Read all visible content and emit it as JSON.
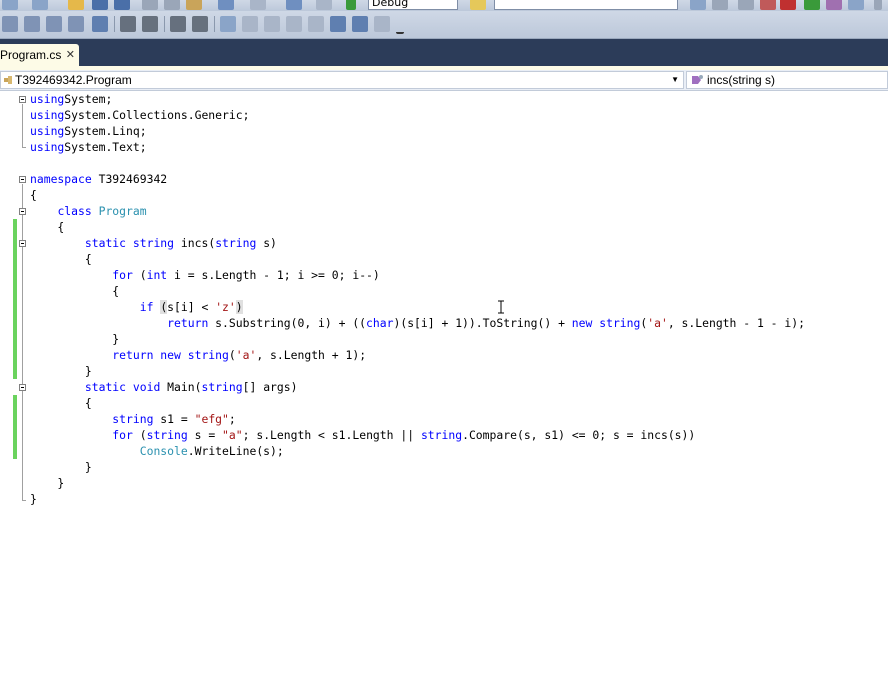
{
  "toolbar": {
    "config_value": "Debug",
    "find_value": ""
  },
  "tab": {
    "label": "Program.cs",
    "close_glyph": "✕"
  },
  "navbar": {
    "type_selector": "T392469342.Program",
    "member_selector": "incs(string s)"
  },
  "code": {
    "l1": [
      [
        "kw",
        "using"
      ],
      [
        "",
        "System;"
      ]
    ],
    "l2": [
      [
        "kw",
        "using"
      ],
      [
        "",
        "System.Collections.Generic;"
      ]
    ],
    "l3": [
      [
        "kw",
        "using"
      ],
      [
        "",
        "System.Linq;"
      ]
    ],
    "l4": [
      [
        "kw",
        "using"
      ],
      [
        "",
        "System.Text;"
      ]
    ],
    "l6": [
      [
        "kw",
        "namespace"
      ],
      [
        "",
        " T392469342"
      ]
    ],
    "l7": [
      [
        "",
        "{"
      ]
    ],
    "l8": [
      [
        "",
        "    "
      ],
      [
        "kw",
        "class"
      ],
      [
        "",
        ""
      ],
      [
        "ty",
        "Program"
      ]
    ],
    "l9": [
      [
        "",
        "    {"
      ]
    ],
    "l10": [
      [
        "",
        "        "
      ],
      [
        "kw",
        "static string"
      ],
      [
        "",
        " incs("
      ],
      [
        "kw",
        "string"
      ],
      [
        "",
        " s)"
      ]
    ],
    "l11": [
      [
        "",
        "        {"
      ]
    ],
    "l12": [
      [
        "",
        "            "
      ],
      [
        "kw",
        "for"
      ],
      [
        "",
        " ("
      ],
      [
        "kw",
        "int"
      ],
      [
        "",
        " i = s.Length - 1; i >= 0; i--)"
      ]
    ],
    "l13": [
      [
        "",
        "            {"
      ]
    ],
    "l14": [
      [
        "",
        "                "
      ],
      [
        "kw",
        "if"
      ],
      [
        "",
        " "
      ],
      [
        "hl",
        "("
      ],
      [
        "",
        "s[i] < "
      ],
      [
        "st",
        "'z'"
      ],
      [
        "hl",
        ")"
      ]
    ],
    "l15": [
      [
        "",
        "                    "
      ],
      [
        "kw",
        "return"
      ],
      [
        "",
        " s.Substring(0, i) + (("
      ],
      [
        "kw",
        "char"
      ],
      [
        "",
        ")(s[i] + 1)).ToString() + "
      ],
      [
        "kw",
        "new string"
      ],
      [
        "",
        "("
      ],
      [
        "st",
        "'a'"
      ],
      [
        "",
        ", s.Length - 1 - i);"
      ]
    ],
    "l16": [
      [
        "",
        "            }"
      ]
    ],
    "l17": [
      [
        "",
        "            "
      ],
      [
        "kw",
        "return new string"
      ],
      [
        "",
        "("
      ],
      [
        "st",
        "'a'"
      ],
      [
        "",
        ", s.Length + 1);"
      ]
    ],
    "l18": [
      [
        "",
        "        }"
      ]
    ],
    "l19": [
      [
        "",
        "        "
      ],
      [
        "kw",
        "static void"
      ],
      [
        "",
        " Main("
      ],
      [
        "kw",
        "string"
      ],
      [
        "",
        "[] args)"
      ]
    ],
    "l20": [
      [
        "",
        "        {"
      ]
    ],
    "l21": [
      [
        "",
        "            "
      ],
      [
        "kw",
        "string"
      ],
      [
        "",
        " s1 = "
      ],
      [
        "st",
        "\"efg\""
      ],
      [
        "",
        ";"
      ]
    ],
    "l22": [
      [
        "",
        "            "
      ],
      [
        "kw",
        "for"
      ],
      [
        "",
        " ("
      ],
      [
        "kw",
        "string"
      ],
      [
        "",
        " s = "
      ],
      [
        "st",
        "\"a\""
      ],
      [
        "",
        "; s.Length < s1.Length || "
      ],
      [
        "kw",
        "string"
      ],
      [
        "",
        ".Compare(s, s1) <= 0; s = incs(s))"
      ]
    ],
    "l23": [
      [
        "",
        "                "
      ],
      [
        "ty",
        "Console"
      ],
      [
        "",
        ".WriteLine(s);"
      ]
    ],
    "l24": [
      [
        "",
        "        }"
      ]
    ],
    "l25": [
      [
        "",
        "    }"
      ]
    ],
    "l26": [
      [
        "",
        "}"
      ]
    ]
  },
  "colors": {
    "keyword": "#0000ff",
    "type": "#2b91af",
    "string": "#a31515",
    "change_margin": "#6bd35e",
    "tab_strip": "#2c3c59"
  }
}
